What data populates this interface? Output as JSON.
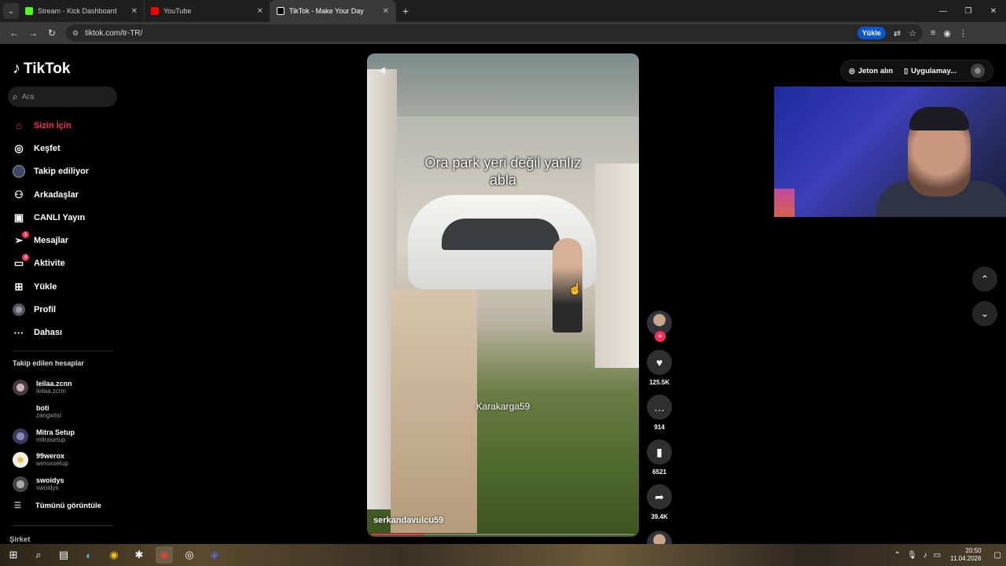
{
  "browser": {
    "tabs": [
      {
        "title": "Stream - Kick Dashboard",
        "color": "#53fc18"
      },
      {
        "title": "YouTube",
        "color": "#ff0000"
      },
      {
        "title": "TikTok - Make Your Day",
        "color": "#ffffff",
        "active": true
      }
    ],
    "url": "tiktok.com/tr-TR/",
    "install_label": "Yükle"
  },
  "tiktok": {
    "logo_text": "TikTok",
    "search": {
      "placeholder": "Ara"
    },
    "nav": [
      {
        "label": "Sizin İçin",
        "icon": "home-icon",
        "active": true
      },
      {
        "label": "Keşfet",
        "icon": "compass-icon"
      },
      {
        "label": "Takip ediliyor",
        "icon": "avatar-icon"
      },
      {
        "label": "Arkadaşlar",
        "icon": "people-icon"
      },
      {
        "label": "CANLI Yayın",
        "icon": "live-tv-icon"
      },
      {
        "label": "Mesajlar",
        "icon": "send-icon",
        "badge": "1"
      },
      {
        "label": "Aktivite",
        "icon": "activity-icon",
        "badge": "4"
      },
      {
        "label": "Yükle",
        "icon": "upload-icon"
      },
      {
        "label": "Profil",
        "icon": "profile-icon"
      },
      {
        "label": "Dahası",
        "icon": "more-icon"
      }
    ],
    "following_header": "Takip edilen hesaplar",
    "following": [
      {
        "name": "leilaa.zcnn",
        "handle": "leilaa.zcnn",
        "color": "#7a6a70"
      },
      {
        "name": "boti",
        "handle": "zangwtsr",
        "color": "#000000"
      },
      {
        "name": "Mitra Setup",
        "handle": "mitrasetup",
        "color": "#5a5a8a"
      },
      {
        "name": "99werox",
        "handle": "weroxsetup",
        "color": "#e8e0b8"
      },
      {
        "name": "swoidys",
        "handle": "swoidys",
        "color": "#6b6b6b"
      }
    ],
    "see_all": "Tümünü görüntüle",
    "company": "Şirket",
    "top_right": {
      "coins": "Jeton alın",
      "app": "Uygulamay..."
    },
    "video": {
      "caption_line1": "Ora park yeri değil yanlız",
      "caption_line2": "abla",
      "watermark": "Karakarga59",
      "author": "serkandavulcu59",
      "progress": 0.2
    },
    "actions": {
      "likes": "125.5K",
      "comments": "914",
      "saves": "6521",
      "shares": "39.4K"
    }
  },
  "taskbar": {
    "time": "20:50",
    "date": "11.04.2026"
  }
}
